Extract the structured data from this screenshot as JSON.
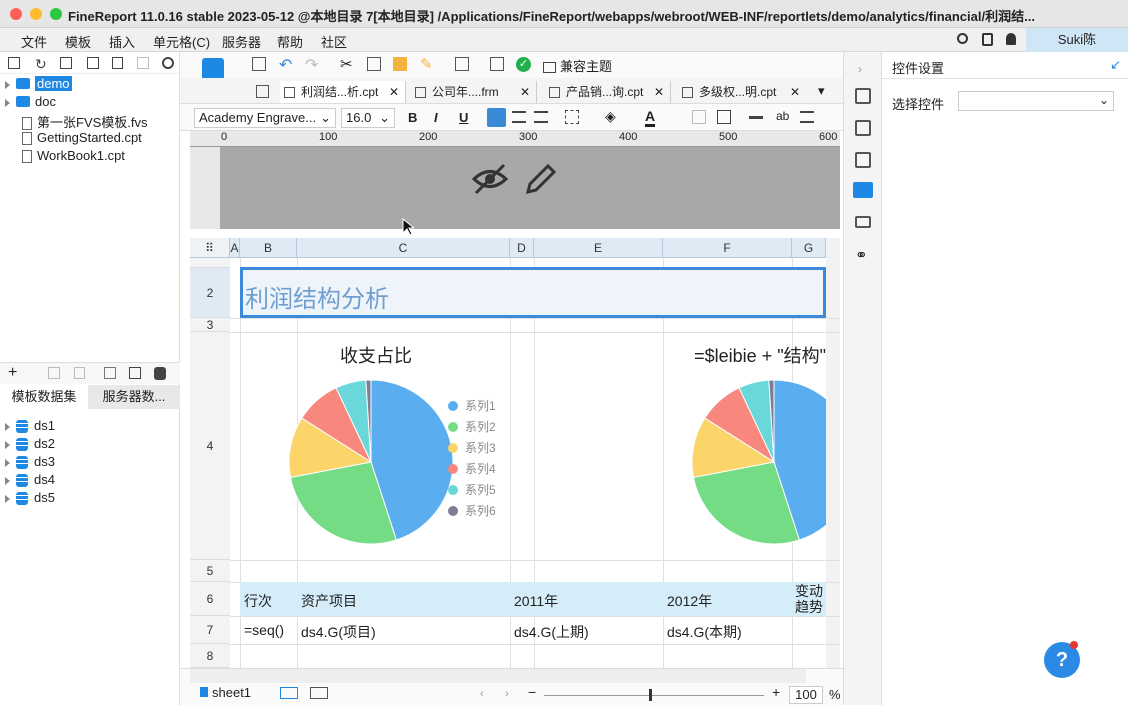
{
  "titlebar": {
    "title": "FineReport 11.0.16 stable 2023-05-12 @本地目录 7[本地目录]   /Applications/FineReport/webapps/webroot/WEB-INF/reportlets/demo/analytics/financial/利润结..."
  },
  "menubar": {
    "items": [
      "文件",
      "模板",
      "插入",
      "单元格(C)",
      "服务器",
      "帮助",
      "社区"
    ],
    "user": "Suki陈"
  },
  "filetree": {
    "items": [
      {
        "label": "demo",
        "type": "folder",
        "selected": true
      },
      {
        "label": "doc",
        "type": "folder"
      },
      {
        "label": "第一张FVS模板.fvs",
        "type": "file"
      },
      {
        "label": "GettingStarted.cpt",
        "type": "file"
      },
      {
        "label": "WorkBook1.cpt",
        "type": "file"
      }
    ]
  },
  "datasets": {
    "tabs": [
      "模板数据集",
      "服务器数..."
    ],
    "items": [
      "ds1",
      "ds2",
      "ds3",
      "ds4",
      "ds5"
    ]
  },
  "toolbar": {
    "theme_label": "兼容主题"
  },
  "tabs": [
    {
      "label": "利润结...析.cpt"
    },
    {
      "label": "公司年....frm"
    },
    {
      "label": "产品销...询.cpt"
    },
    {
      "label": "多级权...明.cpt"
    }
  ],
  "format": {
    "font": "Academy Engrave...",
    "size": "16.0"
  },
  "ruler": {
    "ticks": [
      "0",
      "100",
      "200",
      "300",
      "400",
      "500",
      "600"
    ]
  },
  "grid": {
    "columns": [
      "A",
      "B",
      "C",
      "D",
      "E",
      "F",
      "G"
    ],
    "rows": [
      "2",
      "3",
      "4",
      "5",
      "6",
      "7",
      "8"
    ],
    "title_cell": "利润结构分析",
    "chart1_title": "收支占比",
    "chart2_title": "=$leibie + \"结构\"",
    "header_row": [
      "行次",
      "资产项目",
      "2011年",
      "2012年",
      "变动趋势"
    ],
    "formula_row": [
      "=seq()",
      "ds4.G(项目)",
      "ds4.G(上期)",
      "ds4.G(本期)"
    ]
  },
  "chart_data": {
    "type": "pie",
    "series": [
      {
        "name": "系列1",
        "value": 45,
        "color": "#5aaef0"
      },
      {
        "name": "系列2",
        "value": 27,
        "color": "#74dc84"
      },
      {
        "name": "系列3",
        "value": 12,
        "color": "#fbd46a"
      },
      {
        "name": "系列4",
        "value": 9,
        "color": "#f8877e"
      },
      {
        "name": "系列5",
        "value": 6,
        "color": "#6ad7da"
      },
      {
        "name": "系列6",
        "value": 1,
        "color": "#7d7d95"
      }
    ]
  },
  "rightpanel": {
    "title": "控件设置",
    "select_label": "选择控件"
  },
  "statusbar": {
    "sheet": "sheet1",
    "zoom": "100",
    "zoom_unit": "%"
  }
}
